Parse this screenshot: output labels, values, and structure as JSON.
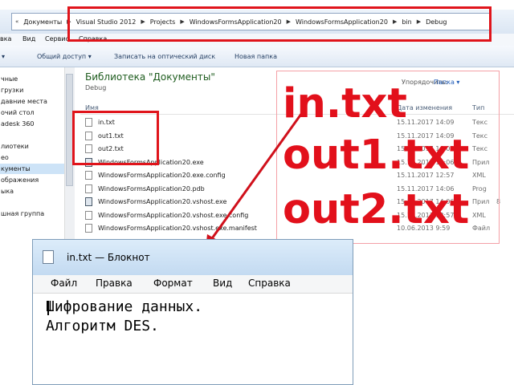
{
  "explorer": {
    "breadcrumbs": [
      "Документы",
      "Visual Studio 2012",
      "Projects",
      "WindowsFormsApplication20",
      "WindowsFormsApplication20",
      "bin",
      "Debug"
    ],
    "menu": [
      "вка",
      "Вид",
      "Сервис",
      "Справка"
    ],
    "toolbar": [
      "Общий доступ ▾",
      "Записать на оптический диск",
      "Новая папка"
    ],
    "sidebar": [
      "чные",
      "грузки",
      "давние места",
      "очий стол",
      "adesk 360",
      "",
      "лиотеки",
      "ео",
      "кументы",
      "ображения",
      "ыка",
      "",
      "шная группа"
    ],
    "library_title": "Библиотека \"Документы\"",
    "library_subtitle": "Debug",
    "arrange_label": "Упорядочить:",
    "arrange_value": "Папка ▾",
    "columns": {
      "name": "Имя",
      "date": "Дата изменения",
      "type": "Тип"
    },
    "files": [
      {
        "name": "in.txt",
        "date": "15.11.2017 14:09",
        "type": "Текс",
        "icon": "text-file-icon"
      },
      {
        "name": "out1.txt",
        "date": "15.11.2017 14:09",
        "type": "Текс",
        "icon": "text-file-icon"
      },
      {
        "name": "out2.txt",
        "date": "15.11.2017 14:09",
        "type": "Текс",
        "icon": "text-file-icon"
      },
      {
        "name": "WindowsFormsApplication20.exe",
        "date": "15.11.2017 14:06",
        "type": "Прил",
        "icon": "exe-file-icon"
      },
      {
        "name": "WindowsFormsApplication20.exe.config",
        "date": "15.11.2017 12:57",
        "type": "XML",
        "icon": "config-file-icon"
      },
      {
        "name": "WindowsFormsApplication20.pdb",
        "date": "15.11.2017 14:06",
        "type": "Prog",
        "icon": "pdb-file-icon"
      },
      {
        "name": "WindowsFormsApplication20.vshost.exe",
        "date": "15.11.2017 14:06",
        "type": "Прил",
        "size": "8",
        "icon": "exe-file-icon"
      },
      {
        "name": "WindowsFormsApplication20.vshost.exe.config",
        "date": "15.11.2017 12:57",
        "type": "XML",
        "icon": "config-file-icon"
      },
      {
        "name": "WindowsFormsApplication20.vshost.exe.manifest",
        "date": "10.06.2013 9:59",
        "type": "Файл",
        "icon": "manifest-file-icon"
      }
    ]
  },
  "annotation": {
    "labels": [
      "in.txt",
      "out1.txt",
      "out2.txt"
    ],
    "color": "#e2101b"
  },
  "notepad": {
    "title": "in.txt — Блокнот",
    "menu": [
      "Файл",
      "Правка",
      "Формат",
      "Вид",
      "Справка"
    ],
    "content": "Шифрование данных.\nАлгоритм DES."
  }
}
